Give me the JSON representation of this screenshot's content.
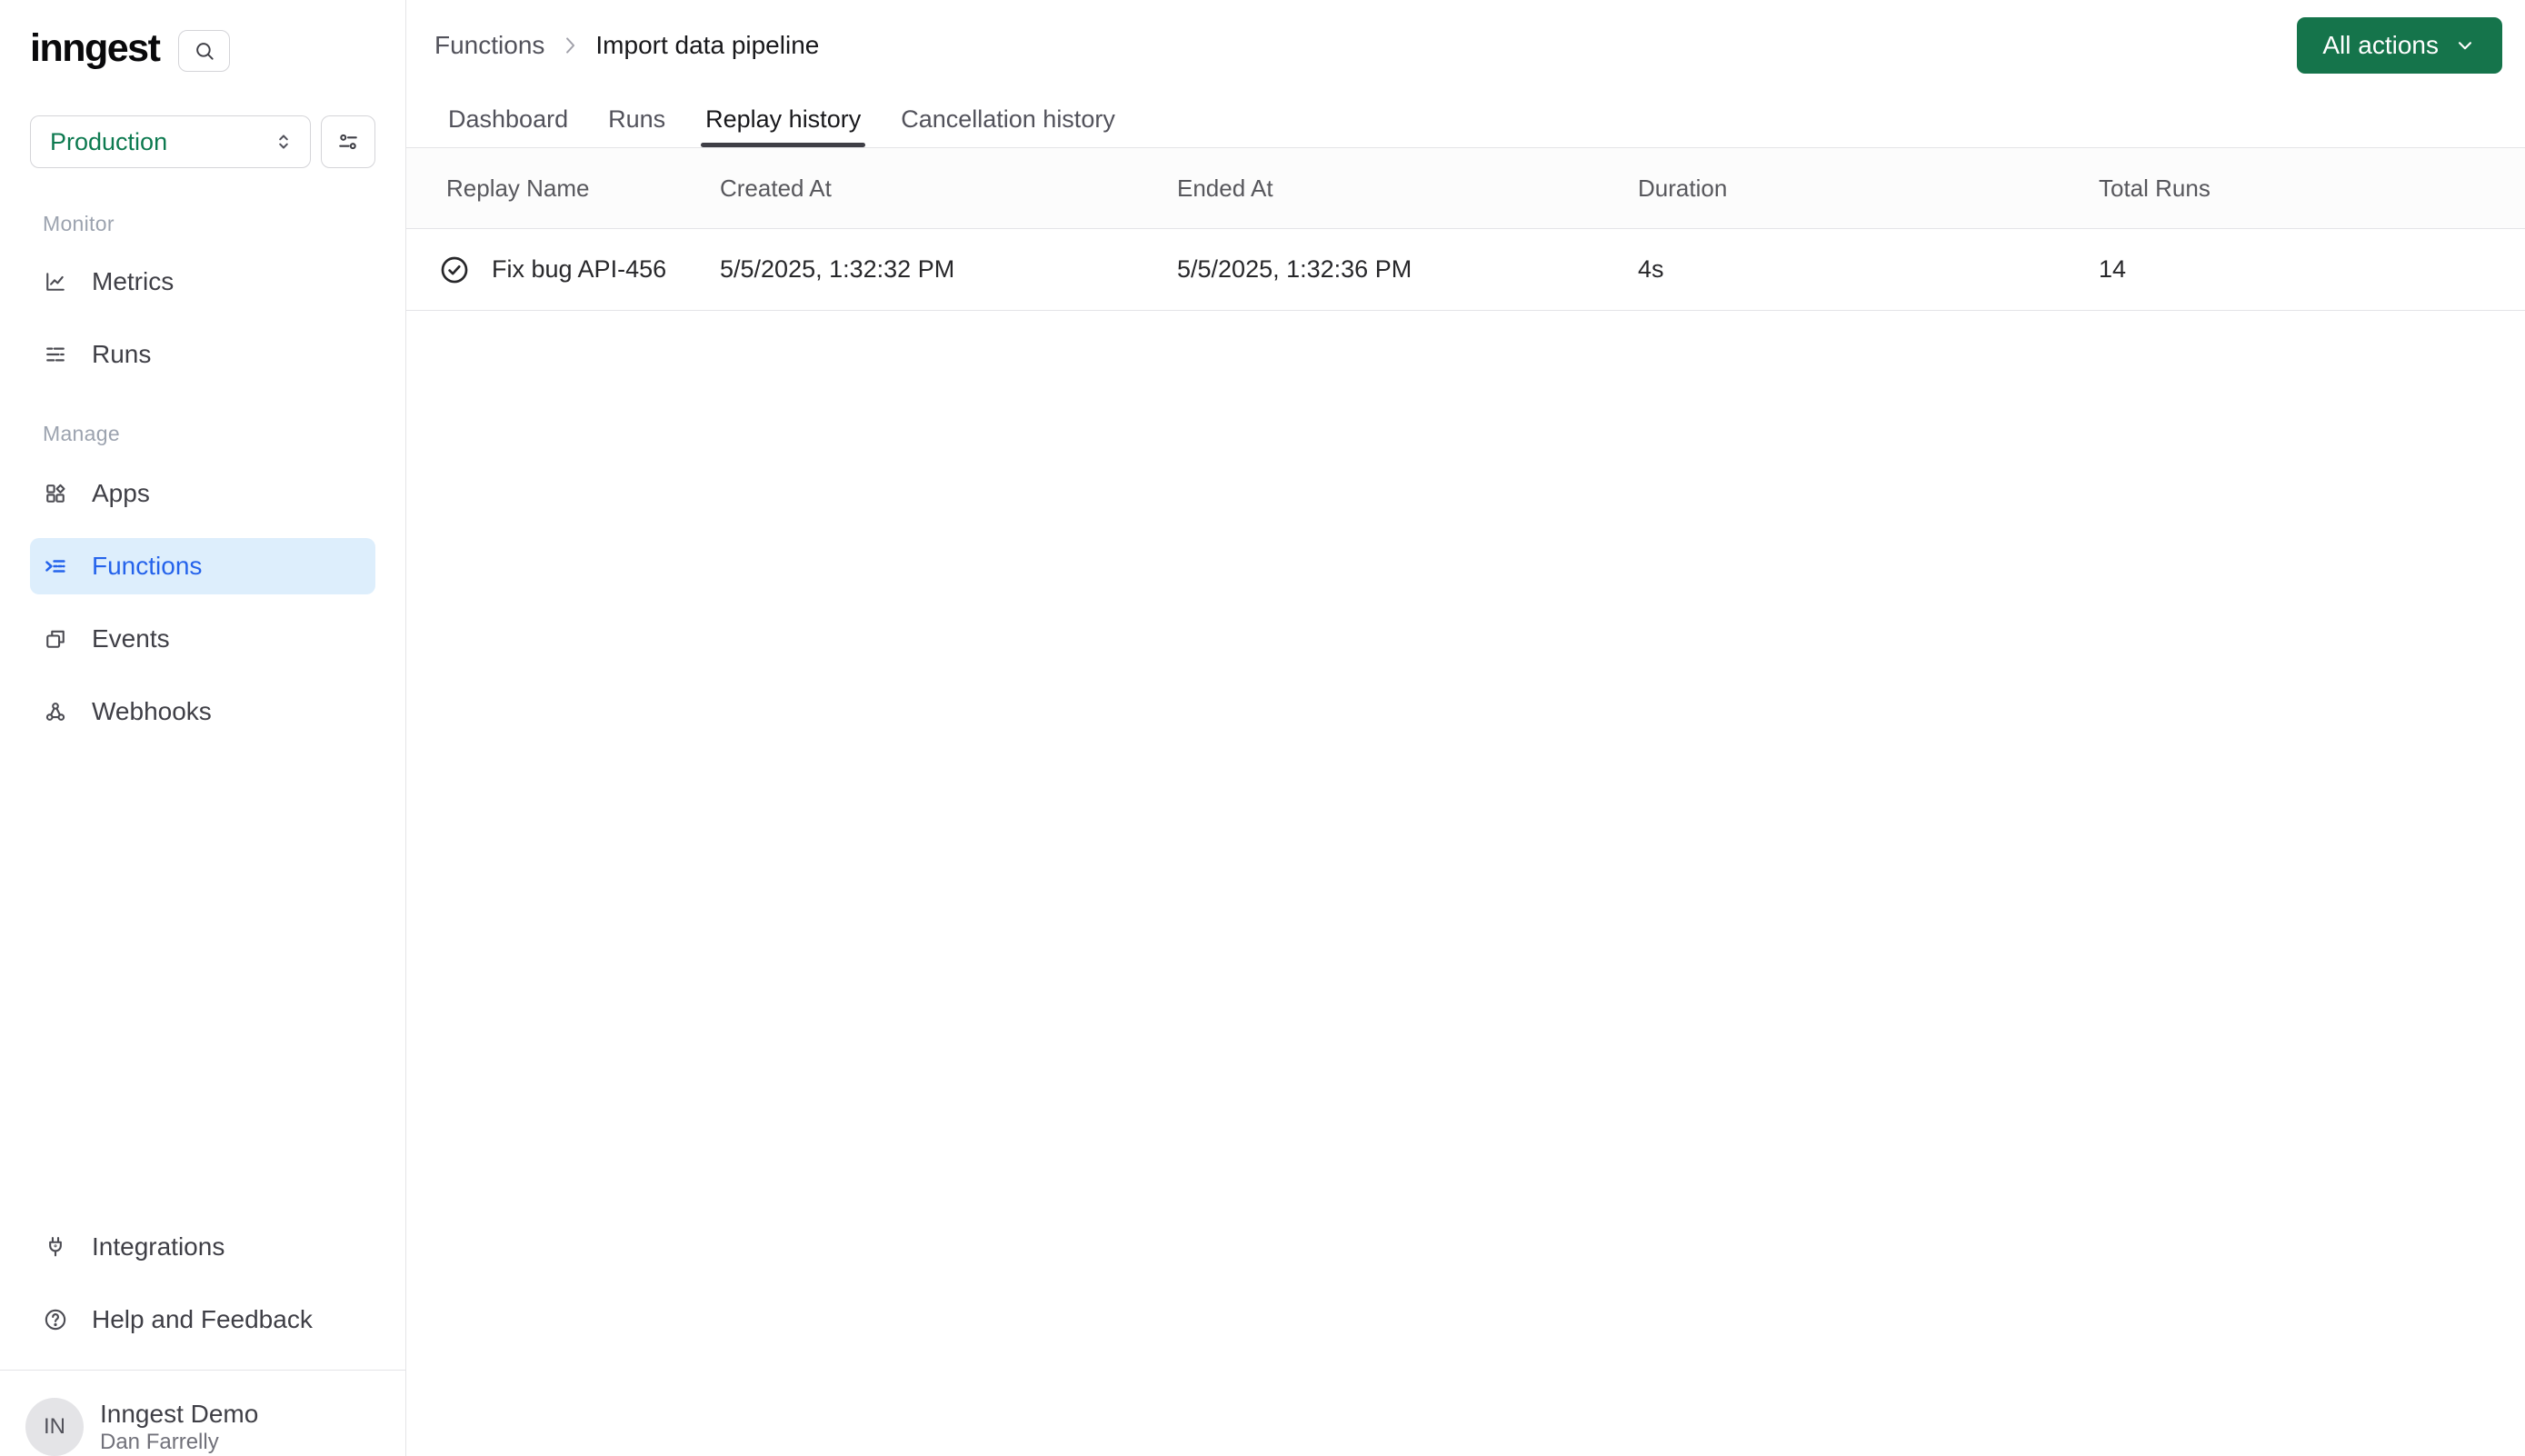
{
  "app": {
    "logo_text": "inngest"
  },
  "sidebar": {
    "env_selector": {
      "value": "Production"
    },
    "sections": [
      {
        "label": "Monitor",
        "items": [
          {
            "icon": "chart-line-icon",
            "label": "Metrics"
          },
          {
            "icon": "runs-list-icon",
            "label": "Runs"
          }
        ]
      },
      {
        "label": "Manage",
        "items": [
          {
            "icon": "apps-grid-icon",
            "label": "Apps"
          },
          {
            "icon": "functions-icon",
            "label": "Functions",
            "active": true
          },
          {
            "icon": "events-icon",
            "label": "Events"
          },
          {
            "icon": "webhooks-icon",
            "label": "Webhooks"
          }
        ]
      }
    ],
    "footer_items": [
      {
        "icon": "plug-icon",
        "label": "Integrations"
      },
      {
        "icon": "help-circle-icon",
        "label": "Help and Feedback"
      }
    ],
    "user": {
      "initials": "IN",
      "org": "Inngest Demo",
      "name": "Dan Farrelly"
    }
  },
  "header": {
    "breadcrumb": {
      "parent": "Functions",
      "current": "Import data pipeline"
    },
    "actions_button": "All actions"
  },
  "tabs": [
    {
      "label": "Dashboard"
    },
    {
      "label": "Runs"
    },
    {
      "label": "Replay history",
      "active": true
    },
    {
      "label": "Cancellation history"
    }
  ],
  "table": {
    "columns": [
      "Replay Name",
      "Created At",
      "Ended At",
      "Duration",
      "Total Runs"
    ],
    "rows": [
      {
        "status_icon": "check-circle-icon",
        "name": "Fix bug API-456",
        "created_at": "5/5/2025, 1:32:32 PM",
        "ended_at": "5/5/2025, 1:32:36 PM",
        "duration": "4s",
        "total_runs": "14"
      }
    ]
  },
  "colors": {
    "button_green": "#15744b",
    "env_green": "#0d7a50",
    "active_blue": "#2563eb",
    "active_blue_bg": "#ddeefc",
    "border": "#e4e4e7"
  }
}
